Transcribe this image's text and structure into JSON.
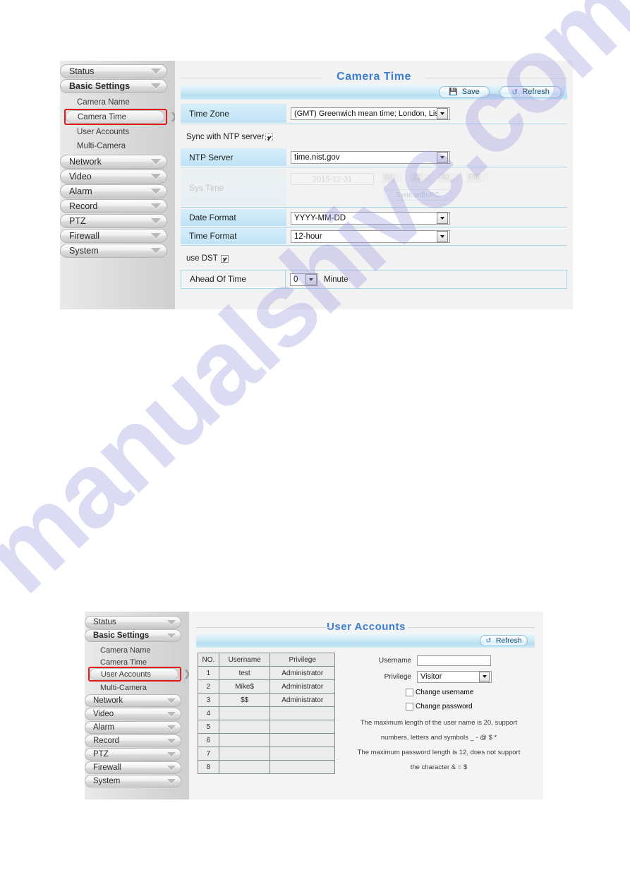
{
  "watermark": {
    "text": "manualshive.com",
    "color": "#9c98e0"
  },
  "theme": {
    "title_color": "#3b7fd4",
    "label_bg": "#bfe3f5",
    "toolbar_bg": "#b6dff1",
    "highlight_border": "#e01b1b"
  },
  "panel_camera_time": {
    "title": "Camera Time",
    "toolbar": {
      "save_label": "Save",
      "refresh_label": "Refresh",
      "save_icon": "save-disk-icon",
      "refresh_icon": "refresh-arrow-icon"
    },
    "sidebar": {
      "groups": [
        {
          "label": "Status",
          "caret": "chevron-down-icon"
        },
        {
          "label": "Basic Settings",
          "caret": "chevron-down-icon"
        }
      ],
      "sub_items": [
        {
          "label": "Camera Name",
          "selected": false
        },
        {
          "label": "Camera Time",
          "selected": true
        },
        {
          "label": "User Accounts",
          "selected": false
        },
        {
          "label": "Multi-Camera",
          "selected": false
        }
      ],
      "groups_lower": [
        {
          "label": "Network",
          "caret": "chevron-down-icon"
        },
        {
          "label": "Video",
          "caret": "chevron-down-icon"
        },
        {
          "label": "Alarm",
          "caret": "chevron-down-icon"
        },
        {
          "label": "Record",
          "caret": "chevron-down-icon"
        },
        {
          "label": "PTZ",
          "caret": "chevron-down-icon"
        },
        {
          "label": "Firewall",
          "caret": "chevron-down-icon"
        },
        {
          "label": "System",
          "caret": "chevron-down-icon"
        }
      ]
    },
    "fields": {
      "time_zone_label": "Time Zone",
      "time_zone_value": "(GMT) Greenwich mean time; London, Lisbon,",
      "sync_ntp_label": "Sync with NTP server",
      "sync_ntp_checked": true,
      "ntp_server_label": "NTP Server",
      "ntp_server_value": "time.nist.gov",
      "system_time_label": "Sys Time",
      "system_time_date": "2015-12-31",
      "system_time_hour": "02",
      "system_time_minute": "21",
      "system_time_second": "40",
      "system_time_ampm": "PM",
      "sync_pc_button": "Sync with PC",
      "date_format_label": "Date Format",
      "date_format_value": "YYYY-MM-DD",
      "time_format_label": "Time Format",
      "time_format_value": "12-hour",
      "use_dst_label": "use DST",
      "use_dst_checked": true,
      "ahead_of_time_label": "Ahead Of Time",
      "ahead_of_time_value": "0",
      "ahead_of_time_unit": "Minute"
    }
  },
  "panel_user_accounts": {
    "title": "User Accounts",
    "toolbar": {
      "refresh_label": "Refresh",
      "refresh_icon": "refresh-arrow-icon"
    },
    "sidebar": {
      "groups": [
        {
          "label": "Status",
          "caret": "chevron-down-icon"
        },
        {
          "label": "Basic Settings",
          "caret": "chevron-down-icon"
        }
      ],
      "sub_items": [
        {
          "label": "Camera Name",
          "selected": false
        },
        {
          "label": "Camera Time",
          "selected": false
        },
        {
          "label": "User Accounts",
          "selected": true
        },
        {
          "label": "Multi-Camera",
          "selected": false
        }
      ],
      "groups_lower": [
        {
          "label": "Network",
          "caret": "chevron-down-icon"
        },
        {
          "label": "Video",
          "caret": "chevron-down-icon"
        },
        {
          "label": "Alarm",
          "caret": "chevron-down-icon"
        },
        {
          "label": "Record",
          "caret": "chevron-down-icon"
        },
        {
          "label": "PTZ",
          "caret": "chevron-down-icon"
        },
        {
          "label": "Firewall",
          "caret": "chevron-down-icon"
        },
        {
          "label": "System",
          "caret": "chevron-down-icon"
        }
      ]
    },
    "table": {
      "headers": [
        "NO.",
        "Username",
        "Privilege"
      ],
      "rows": [
        {
          "no": "1",
          "username": "test",
          "privilege": "Administrator"
        },
        {
          "no": "2",
          "username": "Mike$",
          "privilege": "Administrator"
        },
        {
          "no": "3",
          "username": "$$",
          "privilege": "Administrator"
        },
        {
          "no": "4",
          "username": "",
          "privilege": ""
        },
        {
          "no": "5",
          "username": "",
          "privilege": ""
        },
        {
          "no": "6",
          "username": "",
          "privilege": ""
        },
        {
          "no": "7",
          "username": "",
          "privilege": ""
        },
        {
          "no": "8",
          "username": "",
          "privilege": ""
        }
      ]
    },
    "form": {
      "username_label": "Username",
      "username_value": "",
      "privilege_label": "Privilege",
      "privilege_value": "Visitor",
      "change_username_label": "Change username",
      "change_username_checked": false,
      "change_password_label": "Change password",
      "change_password_checked": false,
      "help_lines": [
        "The maximum length of the user name is 20, support",
        "numbers, letters and symbols _ - @ $ *",
        "The maximum password length is 12, does not support",
        "the character & = $"
      ]
    }
  }
}
